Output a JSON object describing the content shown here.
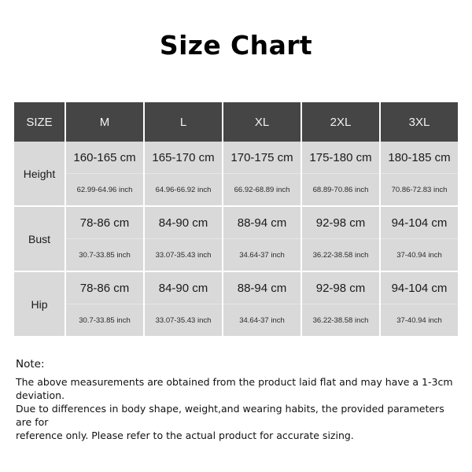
{
  "title": "Size Chart",
  "table": {
    "header": {
      "corner_label": "SIZE",
      "sizes": [
        "M",
        "L",
        "XL",
        "2XL",
        "3XL"
      ]
    },
    "rows": [
      {
        "label": "Height",
        "cm": [
          "160-165 cm",
          "165-170 cm",
          "170-175 cm",
          "175-180 cm",
          "180-185 cm"
        ],
        "inch": [
          "62.99-64.96 inch",
          "64.96-66.92 inch",
          "66.92-68.89 inch",
          "68.89-70.86 inch",
          "70.86-72.83 inch"
        ]
      },
      {
        "label": "Bust",
        "cm": [
          "78-86 cm",
          "84-90 cm",
          "88-94 cm",
          "92-98 cm",
          "94-104 cm"
        ],
        "inch": [
          "30.7-33.85 inch",
          "33.07-35.43 inch",
          "34.64-37 inch",
          "36.22-38.58 inch",
          "37-40.94 inch"
        ]
      },
      {
        "label": "Hip",
        "cm": [
          "78-86 cm",
          "84-90 cm",
          "88-94 cm",
          "92-98 cm",
          "94-104 cm"
        ],
        "inch": [
          "30.7-33.85 inch",
          "33.07-35.43 inch",
          "34.64-37 inch",
          "36.22-38.58 inch",
          "37-40.94 inch"
        ]
      }
    ]
  },
  "note": {
    "heading": "Note:",
    "lines": [
      "The above measurements are obtained from the product laid flat and may have a 1-3cm deviation.",
      "Due to differences in body shape, weight,and wearing habits, the provided parameters are for",
      "reference only. Please refer to the actual product for accurate sizing."
    ]
  },
  "colors": {
    "header_bg": "#454545",
    "header_text": "#f2f2f2",
    "cell_bg": "#d9d9d9",
    "cell_text": "#1a1a1a",
    "page_bg": "#ffffff",
    "title_text": "#000000"
  }
}
